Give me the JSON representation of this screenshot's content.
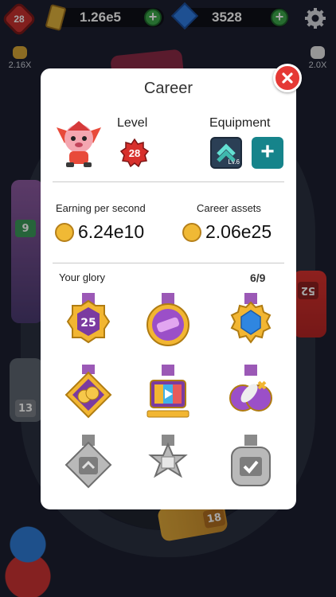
{
  "hud": {
    "player_level": "28",
    "money": "1.26e5",
    "gems": "3528",
    "boost_left": "2.16X",
    "boost_right": "2.0X"
  },
  "track": {
    "car_tags": [
      "9",
      "13",
      "18",
      "52"
    ]
  },
  "career": {
    "title": "Career",
    "level_label": "Level",
    "level_value": "28",
    "equipment_label": "Equipment",
    "equipment_item_level": "Lv.6",
    "earning_label": "Earning per second",
    "earning_value": "6.24e10",
    "assets_label": "Career assets",
    "assets_value": "2.06e25",
    "glory_label": "Your glory",
    "glory_count": "6/9",
    "medals": [
      {
        "name": "level-25-medal",
        "text": "25",
        "unlocked": true
      },
      {
        "name": "purple-car-medal",
        "unlocked": true
      },
      {
        "name": "blue-gem-medal",
        "unlocked": true
      },
      {
        "name": "gold-coins-medal",
        "unlocked": true
      },
      {
        "name": "tv-video-medal",
        "unlocked": true
      },
      {
        "name": "rocket-medal",
        "unlocked": true
      },
      {
        "name": "chevron-card-medal",
        "unlocked": false
      },
      {
        "name": "star-box-medal",
        "unlocked": false
      },
      {
        "name": "checkbox-medal",
        "unlocked": false
      }
    ]
  },
  "colors": {
    "accent_red": "#e53935",
    "teal": "#16848b",
    "gold": "#f0b935",
    "purple": "#7b3ba0"
  }
}
